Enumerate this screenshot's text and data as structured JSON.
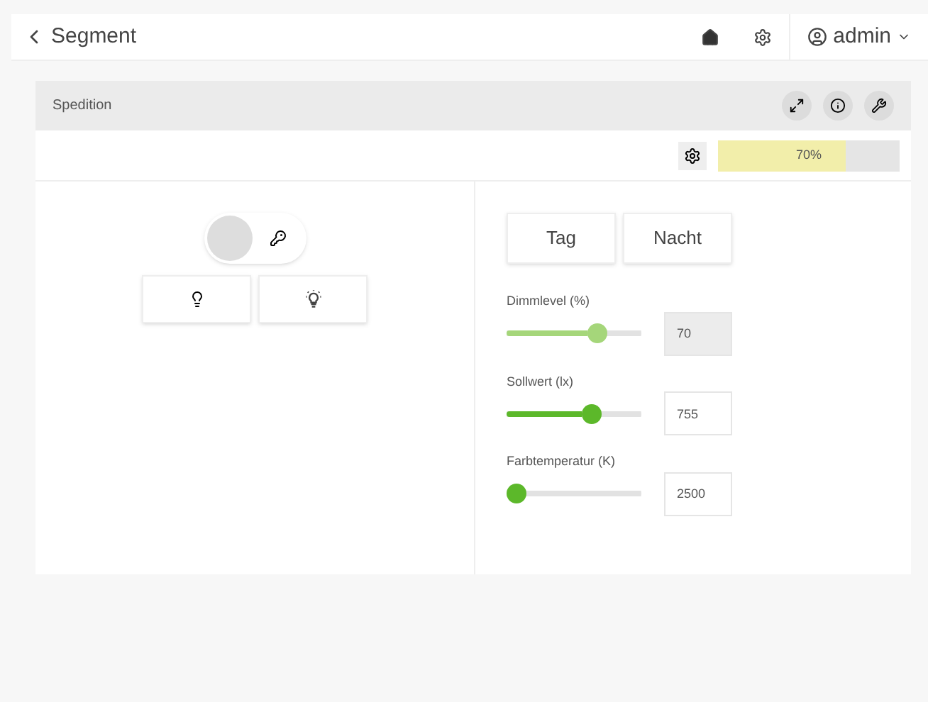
{
  "header": {
    "back_label": "Segment",
    "user": "admin"
  },
  "card": {
    "title": "Spedition",
    "progress": {
      "level": 0.7,
      "label": "70%"
    },
    "switch": {
      "on": false
    },
    "mode_buttons": [
      "Tag",
      "Nacht"
    ],
    "sliders": [
      {
        "label": "Dimmlevel (%)",
        "level": 0.7,
        "value": "70",
        "disabled": true
      },
      {
        "label": "Sollwert (lx)",
        "level": 0.65,
        "value": "755",
        "disabled": false
      },
      {
        "label": "Farbtemperatur (K)",
        "level": 0,
        "value": "2500",
        "disabled": false
      }
    ]
  }
}
